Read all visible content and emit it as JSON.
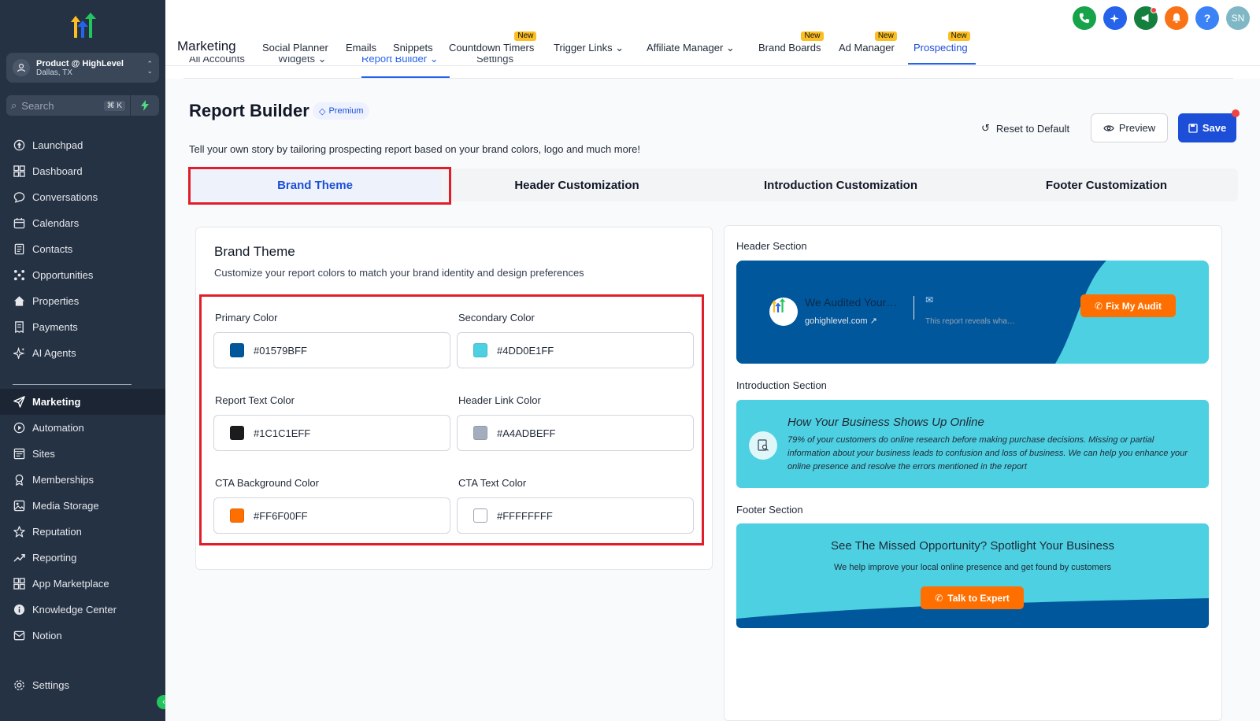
{
  "sidebar": {
    "account": {
      "name": "Product @ HighLevel",
      "location": "Dallas, TX"
    },
    "search": {
      "placeholder": "Search",
      "shortcut": "⌘ K"
    },
    "items": [
      {
        "label": "Launchpad",
        "icon": "launchpad-icon"
      },
      {
        "label": "Dashboard",
        "icon": "dashboard-icon"
      },
      {
        "label": "Conversations",
        "icon": "chat-icon"
      },
      {
        "label": "Calendars",
        "icon": "calendar-icon"
      },
      {
        "label": "Contacts",
        "icon": "contacts-icon"
      },
      {
        "label": "Opportunities",
        "icon": "opportunities-icon"
      },
      {
        "label": "Properties",
        "icon": "home-icon"
      },
      {
        "label": "Payments",
        "icon": "receipt-icon"
      },
      {
        "label": "AI Agents",
        "icon": "sparkle-icon"
      },
      {
        "label": "Marketing",
        "icon": "send-icon"
      },
      {
        "label": "Automation",
        "icon": "automation-icon"
      },
      {
        "label": "Sites",
        "icon": "sites-icon"
      },
      {
        "label": "Memberships",
        "icon": "award-icon"
      },
      {
        "label": "Media Storage",
        "icon": "image-icon"
      },
      {
        "label": "Reputation",
        "icon": "star-icon"
      },
      {
        "label": "Reporting",
        "icon": "trend-icon"
      },
      {
        "label": "App Marketplace",
        "icon": "grid-icon"
      },
      {
        "label": "Knowledge Center",
        "icon": "info-icon"
      },
      {
        "label": "Notion",
        "icon": "notion-icon"
      },
      {
        "label": "Settings",
        "icon": "gear-icon"
      }
    ]
  },
  "topbar": {
    "section": "Marketing",
    "nav": [
      {
        "label": "Social Planner"
      },
      {
        "label": "Emails"
      },
      {
        "label": "Snippets"
      },
      {
        "label": "Countdown Timers",
        "badge": "New"
      },
      {
        "label": "Trigger Links ⌄"
      },
      {
        "label": "Affiliate Manager ⌄"
      },
      {
        "label": "Brand Boards",
        "badge": "New"
      },
      {
        "label": "Ad Manager",
        "badge": "New"
      },
      {
        "label": "Prospecting",
        "badge": "New"
      }
    ],
    "avatar_initials": "SN"
  },
  "subtabs": [
    "All Accounts",
    "Widgets ⌄",
    "Report Builder ⌄",
    "Settings"
  ],
  "page": {
    "title": "Report Builder",
    "premium": "Premium",
    "description": "Tell your own story by tailoring prospecting report based on your brand colors, logo and much more!",
    "reset": "Reset to Default",
    "preview": "Preview",
    "save": "Save"
  },
  "tabs": [
    "Brand Theme",
    "Header Customization",
    "Introduction Customization",
    "Footer Customization"
  ],
  "brand": {
    "title": "Brand Theme",
    "subtitle": "Customize your report colors to match your brand identity and design preferences",
    "fields": [
      {
        "label": "Primary Color",
        "value": "#01579BFF",
        "color": "#01579B"
      },
      {
        "label": "Secondary Color",
        "value": "#4DD0E1FF",
        "color": "#4DD0E1"
      },
      {
        "label": "Report Text Color",
        "value": "#1C1C1EFF",
        "color": "#1C1C1E"
      },
      {
        "label": "Header Link Color",
        "value": "#A4ADBEFF",
        "color": "#A4ADBE"
      },
      {
        "label": "CTA Background Color",
        "value": "#FF6F00FF",
        "color": "#FF6F00"
      },
      {
        "label": "CTA Text Color",
        "value": "#FFFFFFFF",
        "color": "#FFFFFF"
      }
    ]
  },
  "preview": {
    "header_label": "Header Section",
    "header": {
      "audited": "We Audited Your…",
      "link": "gohighlevel.com",
      "reveals": "This report reveals wha…",
      "cta": "Fix My Audit"
    },
    "intro_label": "Introduction Section",
    "intro": {
      "title": "How Your Business Shows Up Online",
      "body": "79% of your customers do online research before making purchase decisions. Missing or partial information about your business leads to confusion and loss of business. We can help you enhance your online presence and resolve the errors mentioned in the report"
    },
    "footer_label": "Footer Section",
    "footer": {
      "title": "See The Missed Opportunity? Spotlight Your Business",
      "subtitle": "We help improve your local online presence and get found by customers",
      "cta": "Talk to Expert"
    }
  }
}
